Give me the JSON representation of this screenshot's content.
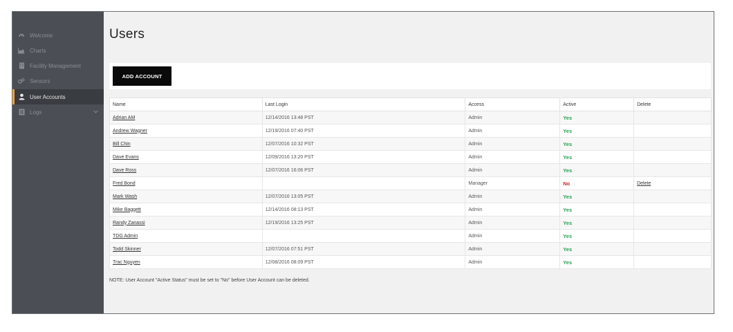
{
  "sidebar": {
    "items": [
      {
        "label": "Welcome",
        "icon": "dashboard-icon"
      },
      {
        "label": "Charts",
        "icon": "area-chart-icon"
      },
      {
        "label": "Facility Management",
        "icon": "building-icon"
      },
      {
        "label": "Sensors",
        "icon": "cogs-icon"
      },
      {
        "label": "User Accounts",
        "icon": "user-icon",
        "active": true
      },
      {
        "label": "Logs",
        "icon": "logs-icon",
        "has_chevron": true
      }
    ]
  },
  "main": {
    "title": "Users",
    "add_button_label": "ADD ACCOUNT",
    "table": {
      "headers": [
        "Name",
        "Last Login",
        "Access",
        "Active",
        "Delete"
      ],
      "rows": [
        {
          "name": "Adrian AM",
          "last_login": "12/14/2016 13:48 PST",
          "access": "Admin",
          "active": "Yes",
          "delete": ""
        },
        {
          "name": "Andrew Wagner",
          "last_login": "12/19/2016 07:40 PST",
          "access": "Admin",
          "active": "Yes",
          "delete": ""
        },
        {
          "name": "Bill Chin",
          "last_login": "12/07/2016 10:32 PST",
          "access": "Admin",
          "active": "Yes",
          "delete": ""
        },
        {
          "name": "Dave Evans",
          "last_login": "12/09/2016 13:20 PST",
          "access": "Admin",
          "active": "Yes",
          "delete": ""
        },
        {
          "name": "Dave Ross",
          "last_login": "12/07/2016 16:06 PST",
          "access": "Admin",
          "active": "Yes",
          "delete": ""
        },
        {
          "name": "Fred Bond",
          "last_login": "",
          "access": "Manager",
          "active": "No",
          "delete": "Delete"
        },
        {
          "name": "Mark Wash",
          "last_login": "12/07/2016 13:05 PST",
          "access": "Admin",
          "active": "Yes",
          "delete": ""
        },
        {
          "name": "Mike Baggett",
          "last_login": "12/14/2016 08:13 PST",
          "access": "Admin",
          "active": "Yes",
          "delete": ""
        },
        {
          "name": "Randy Zanassi",
          "last_login": "12/19/2016 13:25 PST",
          "access": "Admin",
          "active": "Yes",
          "delete": ""
        },
        {
          "name": "TDG Admin",
          "last_login": "",
          "access": "Admin",
          "active": "Yes",
          "delete": ""
        },
        {
          "name": "Todd Skinner",
          "last_login": "12/07/2016 07:51 PST",
          "access": "Admin",
          "active": "Yes",
          "delete": ""
        },
        {
          "name": "Trac Nguyen",
          "last_login": "12/08/2016 08:09 PST",
          "access": "Admin",
          "active": "Yes",
          "delete": ""
        }
      ]
    },
    "note": "NOTE: User Account \"Active Status\" must be set to \"No\" before User Account can be deleted."
  },
  "colors": {
    "sidebar_bg": "#4b4f55",
    "active_accent": "#f2a43a",
    "yes": "#2aa052",
    "no": "#d2232a",
    "button_bg": "#0a0a0a"
  }
}
